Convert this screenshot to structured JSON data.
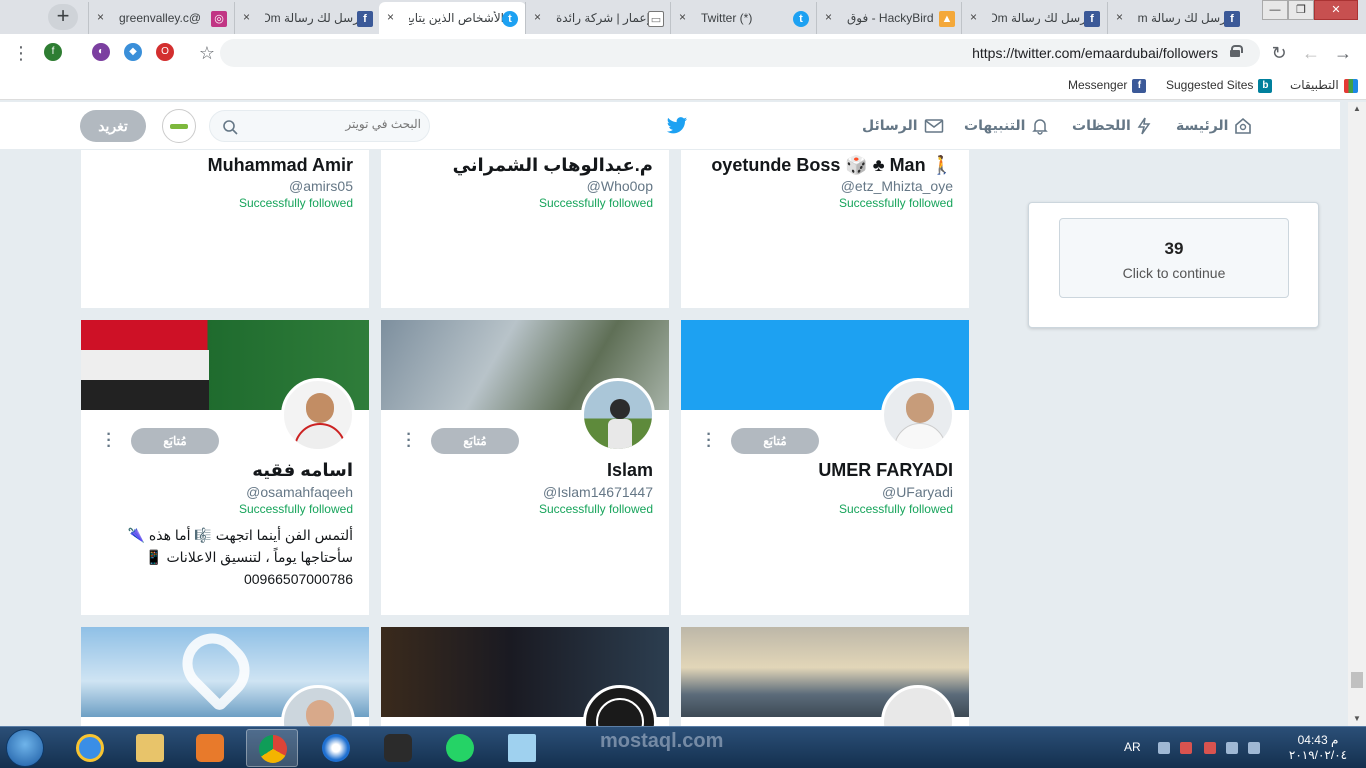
{
  "browser": {
    "tabs": [
      {
        "title": "@greenvalley.c",
        "icon": "instagram-icon"
      },
      {
        "title": "رسل لك رسالة Om",
        "icon": "facebook-icon"
      },
      {
        "title": "الأشخاص الذين يتابع",
        "icon": "twitter-icon",
        "active": true
      },
      {
        "title": "إعمار | شركة رائدة",
        "icon": "document-icon"
      },
      {
        "title": "(*) Twitter",
        "icon": "twitter-icon"
      },
      {
        "title": "HackyBird - فوق",
        "icon": "hackybird-icon"
      },
      {
        "title": "رسل لك رسالة Om",
        "icon": "facebook-icon"
      },
      {
        "title": "رسل لك رسالة Om",
        "icon": "facebook-icon"
      }
    ],
    "new_tab": "+",
    "close_tab": "×",
    "url": "https://twitter.com/emaardubai/followers",
    "bookmarks": [
      {
        "label": "التطبيقات",
        "icon": "apps-grid-icon"
      },
      {
        "label": "Suggested Sites",
        "icon": "bing-icon"
      },
      {
        "label": "Messenger",
        "icon": "facebook-icon"
      }
    ],
    "extensions": [
      "f",
      "ext-purple",
      "ext-blue",
      "opera-icon"
    ],
    "window_controls": {
      "minimize": "—",
      "maximize": "❐",
      "close": "✕"
    }
  },
  "twitter_nav": {
    "home": "الرئيسة",
    "moments": "اللحظات",
    "notifications": "التنبيهات",
    "messages": "الرسائل",
    "search_placeholder": "البحث في تويتر",
    "tweet_button": "تغريد"
  },
  "cards_top": [
    {
      "name": "Muhammad Amir",
      "handle": "@amirs05",
      "status": "Successfully followed"
    },
    {
      "name": "م.عبدالوهاب الشمراني",
      "handle": "@Who0op",
      "status": "Successfully followed"
    },
    {
      "name": "🚶 oyetunde Boss 🎲 ♣ Man",
      "handle": "@etz_Mhizta_oye",
      "status": "Successfully followed"
    }
  ],
  "cards_middle": [
    {
      "name": "اسامه فقيه",
      "handle": "@osamahfaqeeh",
      "status": "Successfully followed",
      "follow_label": "مُتابَع",
      "bio": "ألتمس الفن أينما اتجهت 🎼 أما هذه 🌂 سأحتاجها يوماً ، لتنسيق الاعلانات 📱 00966507000786",
      "banner_color": "#3a6b3a"
    },
    {
      "name": "Islam",
      "handle": "@Islam14671447",
      "status": "Successfully followed",
      "follow_label": "مُتابَع",
      "bio": "",
      "banner_color": "#8a9aa8"
    },
    {
      "name": "UMER FARYADI",
      "handle": "@UFaryadi",
      "status": "Successfully followed",
      "follow_label": "مُتابَع",
      "bio": "",
      "banner_color": "#1da1f2"
    }
  ],
  "sidebar": {
    "count": "39",
    "label": "Click to continue"
  },
  "taskbar": {
    "lang": "AR",
    "time": "04:43 م",
    "date": "٢٠١٩/٠٢/٠٤",
    "apps": [
      "internet-explorer-icon",
      "folder-icon",
      "media-player-icon",
      "chrome-icon",
      "app-blue-icon",
      "nox-icon",
      "whatsapp-icon",
      "notes-icon"
    ]
  },
  "watermark": "mostaql.com",
  "colors": {
    "twitter_blue": "#1da1f2",
    "success_green": "#17a45b",
    "muted": "#657786"
  }
}
